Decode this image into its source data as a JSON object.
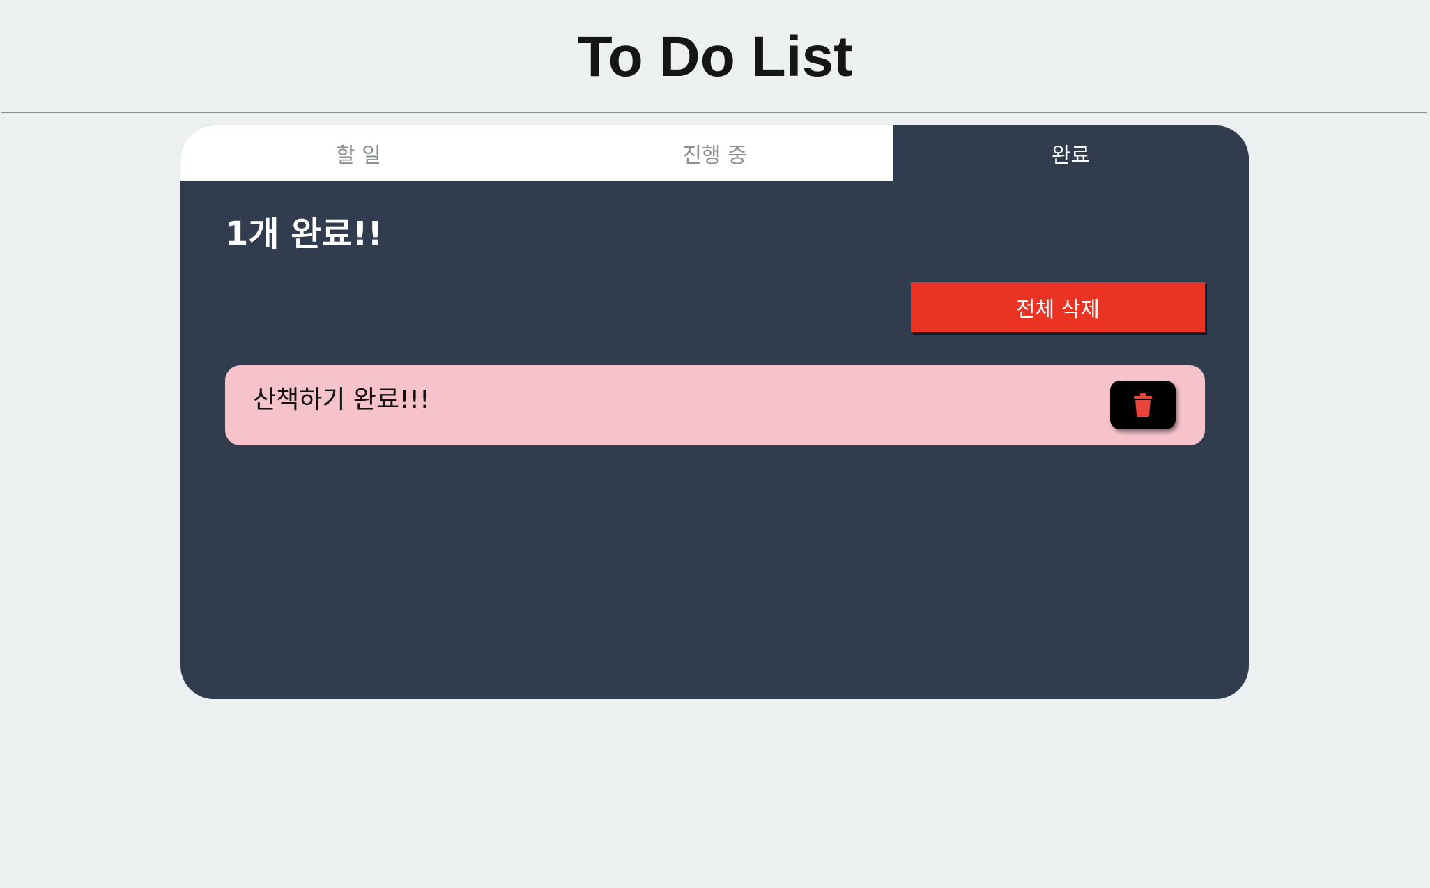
{
  "header": {
    "title": "To Do List"
  },
  "tabs": [
    {
      "label": "할 일",
      "active": false
    },
    {
      "label": "진행 중",
      "active": false
    },
    {
      "label": "완료",
      "active": true
    }
  ],
  "main": {
    "summary": "1개 완료!!",
    "delete_all_label": "전체 삭제",
    "items": [
      {
        "text": "산책하기 완료!!!",
        "icon": "trash-icon"
      }
    ]
  },
  "colors": {
    "background": "#edf0f1",
    "board": "#313d4f",
    "delete_all": "#ea3323",
    "item": "#f6c3cb",
    "trash_icon": "#e7443a"
  }
}
